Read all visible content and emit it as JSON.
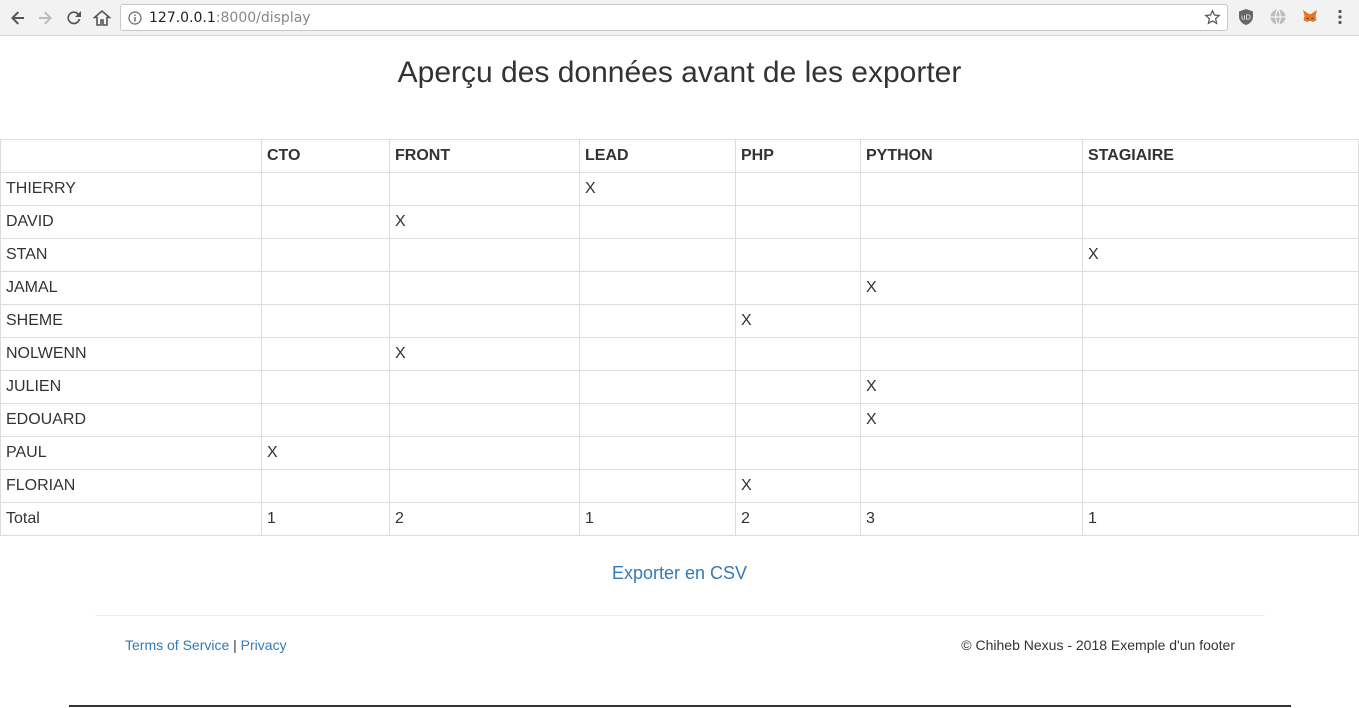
{
  "browser": {
    "url_host": "127.0.0.1",
    "url_path": ":8000/display"
  },
  "page": {
    "title": "Aperçu des données avant de les exporter"
  },
  "table": {
    "columns": [
      "",
      "CTO",
      "FRONT",
      "LEAD",
      "PHP",
      "PYTHON",
      "STAGIAIRE"
    ],
    "rows": [
      [
        "THIERRY",
        "",
        "",
        "X",
        "",
        "",
        ""
      ],
      [
        "DAVID",
        "",
        "X",
        "",
        "",
        "",
        ""
      ],
      [
        "STAN",
        "",
        "",
        "",
        "",
        "",
        "X"
      ],
      [
        "JAMAL",
        "",
        "",
        "",
        "",
        "X",
        ""
      ],
      [
        "SHEME",
        "",
        "",
        "",
        "X",
        "",
        ""
      ],
      [
        "NOLWENN",
        "",
        "X",
        "",
        "",
        "",
        ""
      ],
      [
        "JULIEN",
        "",
        "",
        "",
        "",
        "X",
        ""
      ],
      [
        "EDOUARD",
        "",
        "",
        "",
        "",
        "X",
        ""
      ],
      [
        "PAUL",
        "X",
        "",
        "",
        "",
        "",
        ""
      ],
      [
        "FLORIAN",
        "",
        "",
        "",
        "X",
        "",
        ""
      ],
      [
        "Total",
        "1",
        "2",
        "1",
        "2",
        "3",
        "1"
      ]
    ]
  },
  "export": {
    "label": "Exporter en CSV"
  },
  "footer": {
    "terms_label": "Terms of Service",
    "separator": "|",
    "privacy_label": "Privacy",
    "copyright": "© Chiheb Nexus - 2018 Exemple d'un footer"
  },
  "colors": {
    "link": "#337ab7",
    "text": "#333333",
    "border": "#dddddd"
  }
}
